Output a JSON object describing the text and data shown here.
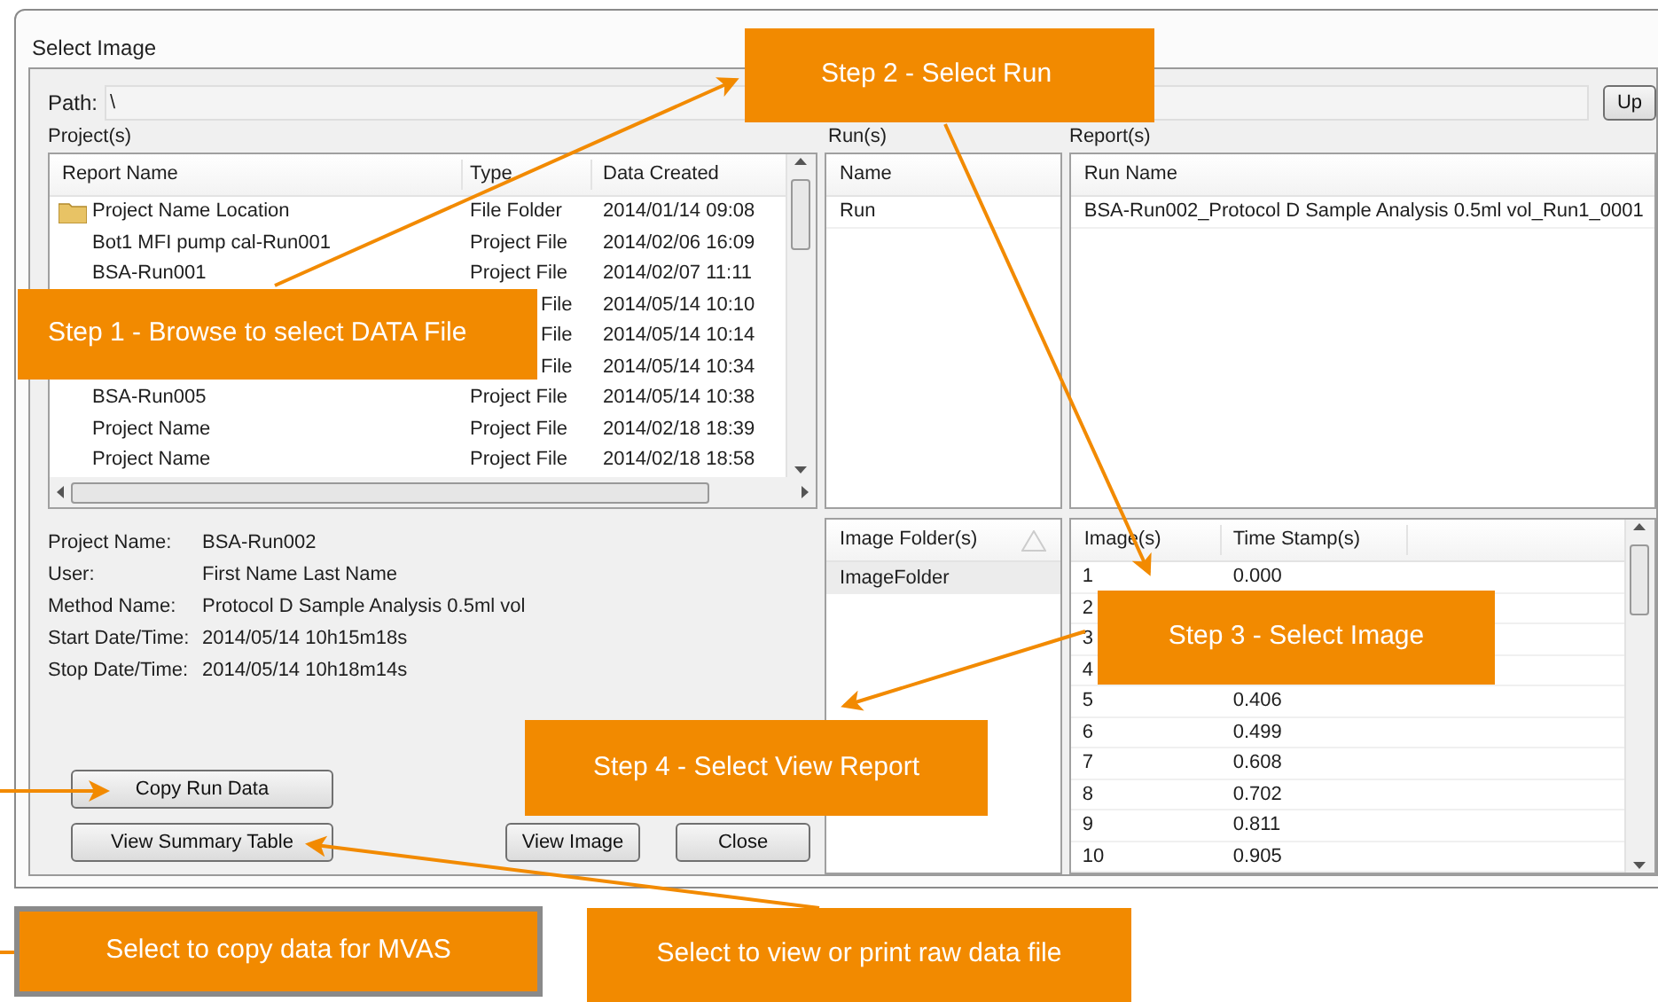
{
  "window": {
    "title": "Select Image"
  },
  "path": {
    "label": "Path:",
    "value": "\\",
    "up_button": "Up"
  },
  "projects": {
    "label": "Project(s)",
    "columns": [
      "Report Name",
      "Type",
      "Data Created"
    ],
    "rows": [
      {
        "kind": "folder",
        "name": "Project Name Location",
        "type": "File Folder",
        "created": "2014/01/14 09:08"
      },
      {
        "kind": "file",
        "name": "Bot1 MFI pump cal-Run001",
        "type": "Project File",
        "created": "2014/02/06 16:09"
      },
      {
        "kind": "file",
        "name": "BSA-Run001",
        "type": "Project File",
        "created": "2014/02/07 11:11"
      },
      {
        "kind": "covered",
        "type": "File",
        "created": "2014/05/14 10:10"
      },
      {
        "kind": "covered",
        "type": "File",
        "created": "2014/05/14 10:14"
      },
      {
        "kind": "covered",
        "type": "File",
        "created": "2014/05/14 10:34"
      },
      {
        "kind": "file",
        "name": "BSA-Run005",
        "type": "Project File",
        "created": "2014/05/14 10:38"
      },
      {
        "kind": "file",
        "name": "Project Name",
        "type": "Project File",
        "created": "2014/02/18 18:39"
      },
      {
        "kind": "file",
        "name": "Project Name",
        "type": "Project File",
        "created": "2014/02/18 18:58"
      }
    ]
  },
  "runs": {
    "label": "Run(s)",
    "column": "Name",
    "rows": [
      "Run"
    ]
  },
  "reports": {
    "label": "Report(s)",
    "column": "Run Name",
    "rows": [
      "BSA-Run002_Protocol D Sample Analysis 0.5ml vol_Run1_0001"
    ]
  },
  "details": [
    {
      "label": "Project Name:",
      "value": "BSA-Run002"
    },
    {
      "label": "User:",
      "value": "First Name Last Name"
    },
    {
      "label": "Method Name:",
      "value": "Protocol D Sample Analysis 0.5ml vol"
    },
    {
      "label": "Start Date/Time:",
      "value": "2014/05/14 10h15m18s"
    },
    {
      "label": "Stop Date/Time:",
      "value": "2014/05/14 10h18m14s"
    }
  ],
  "buttons": {
    "copy": "Copy Run Data",
    "summary": "View Summary Table",
    "view_image": "View Image",
    "close": "Close"
  },
  "image_folders": {
    "column": "Image Folder(s)",
    "rows": [
      {
        "name": "ImageFolder",
        "selected": true
      }
    ]
  },
  "images": {
    "columns": [
      "Image(s)",
      "Time Stamp(s)"
    ],
    "rows": [
      {
        "image": "1",
        "time": "0.000"
      },
      {
        "image": "2"
      },
      {
        "image": "3"
      },
      {
        "image": "4"
      },
      {
        "image": "5",
        "time": "0.406"
      },
      {
        "image": "6",
        "time": "0.499"
      },
      {
        "image": "7",
        "time": "0.608"
      },
      {
        "image": "8",
        "time": "0.702"
      },
      {
        "image": "9",
        "time": "0.811"
      },
      {
        "image": "10",
        "time": "0.905"
      }
    ]
  },
  "callouts": [
    {
      "text": "Step 1 - Browse to select DATA File"
    },
    {
      "text": "Step 2 - Select Run"
    },
    {
      "text": "Step 3 - Select Image"
    },
    {
      "text": "Step 4 - Select View Report"
    },
    {
      "text": "Select to copy data for MVAS"
    },
    {
      "text": "Select to view or print raw data file"
    }
  ]
}
